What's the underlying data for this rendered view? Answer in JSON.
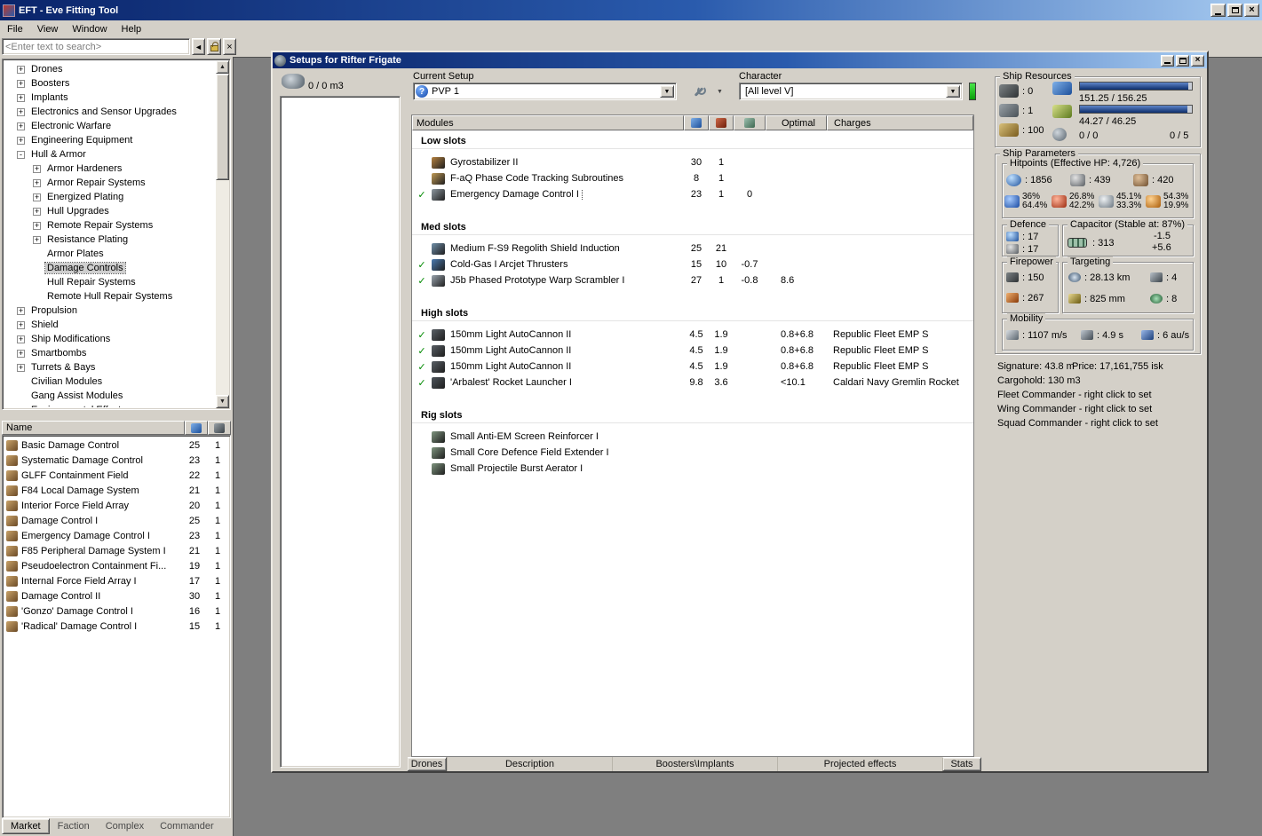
{
  "colors": {
    "titlebar_start": "#0a246a",
    "titlebar_end": "#a6caf0",
    "chrome": "#d4d0c8",
    "workspace": "#7f7f7f",
    "check_green": "#008a00",
    "indicator_green": "#22cc22",
    "bar_fill": "#0d2d6b"
  },
  "icons": {
    "dropdown_arrow": "▼",
    "back_arrow": "◄",
    "close": "×",
    "check": "✓",
    "expand": "+",
    "collapse": "-",
    "question": "?",
    "scroll_up": "▲",
    "scroll_down": "▼"
  },
  "app": {
    "title": "EFT - Eve Fitting Tool",
    "menu": [
      "File",
      "View",
      "Window",
      "Help"
    ],
    "search_placeholder": "<Enter text to search>"
  },
  "tree": {
    "items": [
      {
        "label": "Drones",
        "level": 0,
        "expand": "plus"
      },
      {
        "label": "Boosters",
        "level": 0,
        "expand": "plus"
      },
      {
        "label": "Implants",
        "level": 0,
        "expand": "plus"
      },
      {
        "label": "Electronics and Sensor Upgrades",
        "level": 0,
        "expand": "plus"
      },
      {
        "label": "Electronic Warfare",
        "level": 0,
        "expand": "plus"
      },
      {
        "label": "Engineering Equipment",
        "level": 0,
        "expand": "plus"
      },
      {
        "label": "Hull & Armor",
        "level": 0,
        "expand": "minus"
      },
      {
        "label": "Armor Hardeners",
        "level": 1,
        "expand": "plus"
      },
      {
        "label": "Armor Repair Systems",
        "level": 1,
        "expand": "plus"
      },
      {
        "label": "Energized Plating",
        "level": 1,
        "expand": "plus"
      },
      {
        "label": "Hull Upgrades",
        "level": 1,
        "expand": "plus"
      },
      {
        "label": "Remote Repair Systems",
        "level": 1,
        "expand": "plus"
      },
      {
        "label": "Resistance Plating",
        "level": 1,
        "expand": "plus"
      },
      {
        "label": "Armor Plates",
        "level": 1,
        "expand": null
      },
      {
        "label": "Damage Controls",
        "level": 1,
        "expand": null,
        "selected": true
      },
      {
        "label": "Hull Repair Systems",
        "level": 1,
        "expand": null
      },
      {
        "label": "Remote Hull Repair Systems",
        "level": 1,
        "expand": null
      },
      {
        "label": "Propulsion",
        "level": 0,
        "expand": "plus"
      },
      {
        "label": "Shield",
        "level": 0,
        "expand": "plus"
      },
      {
        "label": "Ship Modifications",
        "level": 0,
        "expand": "plus"
      },
      {
        "label": "Smartbombs",
        "level": 0,
        "expand": "plus"
      },
      {
        "label": "Turrets & Bays",
        "level": 0,
        "expand": "plus"
      },
      {
        "label": "Civilian Modules",
        "level": 0,
        "expand": null
      },
      {
        "label": "Gang Assist Modules",
        "level": 0,
        "expand": null
      },
      {
        "label": "Environmental Effects",
        "level": 0,
        "expand": null
      }
    ]
  },
  "market": {
    "name_column": "Name",
    "rows": [
      {
        "name": "Basic Damage Control",
        "meta": "25",
        "qty": "1"
      },
      {
        "name": "Systematic Damage Control",
        "meta": "23",
        "qty": "1"
      },
      {
        "name": "GLFF Containment Field",
        "meta": "22",
        "qty": "1"
      },
      {
        "name": "F84 Local Damage System",
        "meta": "21",
        "qty": "1"
      },
      {
        "name": "Interior Force Field Array",
        "meta": "20",
        "qty": "1"
      },
      {
        "name": "Damage Control I",
        "meta": "25",
        "qty": "1"
      },
      {
        "name": "Emergency Damage Control I",
        "meta": "23",
        "qty": "1"
      },
      {
        "name": "F85 Peripheral Damage System I",
        "meta": "21",
        "qty": "1"
      },
      {
        "name": "Pseudoelectron Containment Fi...",
        "meta": "19",
        "qty": "1"
      },
      {
        "name": "Internal Force Field Array I",
        "meta": "17",
        "qty": "1"
      },
      {
        "name": "Damage Control II",
        "meta": "30",
        "qty": "1"
      },
      {
        "name": "'Gonzo' Damage Control I",
        "meta": "16",
        "qty": "1"
      },
      {
        "name": "'Radical' Damage Control I",
        "meta": "15",
        "qty": "1"
      }
    ]
  },
  "left_tabs": [
    {
      "label": "Market",
      "active": true
    },
    {
      "label": "Faction",
      "active": false
    },
    {
      "label": "Complex",
      "active": false
    },
    {
      "label": "Commander",
      "active": false
    }
  ],
  "setup": {
    "window_title": "Setups for Rifter Frigate",
    "current_setup_label": "Current Setup",
    "current_setup_value": "PVP 1",
    "character_label": "Character",
    "character_value": "[All level V]",
    "drone_bay_text": "0 / 0 m3",
    "table": {
      "modules_label": "Modules",
      "optimal_label": "Optimal",
      "charges_label": "Charges"
    },
    "sections": [
      {
        "name": "Low slots",
        "rows": [
          {
            "check": false,
            "name": "Gyrostabilizer II",
            "cpu": "30",
            "pg": "1",
            "cap": "",
            "optimal": "",
            "charges": "",
            "icon_color": "#b5813f"
          },
          {
            "check": false,
            "name": "F-aQ Phase Code Tracking Subroutines",
            "cpu": "8",
            "pg": "1",
            "cap": "",
            "optimal": "",
            "charges": "",
            "icon_color": "#c09a55"
          },
          {
            "check": true,
            "selected": true,
            "name": "Emergency Damage Control I",
            "cpu": "23",
            "pg": "1",
            "cap": "0",
            "optimal": "",
            "charges": "",
            "icon_color": "#8e98a0"
          }
        ]
      },
      {
        "name": "Med slots",
        "rows": [
          {
            "check": false,
            "name": "Medium F-S9 Regolith Shield Induction",
            "cpu": "25",
            "pg": "21",
            "cap": "",
            "optimal": "",
            "charges": "",
            "icon_color": "#6f8fa8"
          },
          {
            "check": true,
            "name": "Cold-Gas I Arcjet Thrusters",
            "cpu": "15",
            "pg": "10",
            "cap": "-0.7",
            "optimal": "",
            "charges": "",
            "icon_color": "#4a7ab0"
          },
          {
            "check": true,
            "name": "J5b Phased Prototype Warp Scrambler I",
            "cpu": "27",
            "pg": "1",
            "cap": "-0.8",
            "optimal": "8.6",
            "charges": "",
            "icon_color": "#9aa4ae"
          }
        ]
      },
      {
        "name": "High slots",
        "rows": [
          {
            "check": true,
            "name": "150mm Light AutoCannon II",
            "cpu": "4.5",
            "pg": "1.9",
            "cap": "",
            "optimal": "0.8+6.8",
            "charges": "Republic Fleet EMP S",
            "icon_color": "#5a6066"
          },
          {
            "check": true,
            "name": "150mm Light AutoCannon II",
            "cpu": "4.5",
            "pg": "1.9",
            "cap": "",
            "optimal": "0.8+6.8",
            "charges": "Republic Fleet EMP S",
            "icon_color": "#5a6066"
          },
          {
            "check": true,
            "name": "150mm Light AutoCannon II",
            "cpu": "4.5",
            "pg": "1.9",
            "cap": "",
            "optimal": "0.8+6.8",
            "charges": "Republic Fleet EMP S",
            "icon_color": "#5a6066"
          },
          {
            "check": true,
            "name": "'Arbalest' Rocket Launcher I",
            "cpu": "9.8",
            "pg": "3.6",
            "cap": "",
            "optimal": "<10.1",
            "charges": "Caldari Navy Gremlin Rocket",
            "icon_color": "#4e555c"
          }
        ]
      },
      {
        "name": "Rig slots",
        "rows": [
          {
            "check": false,
            "name": "Small Anti-EM Screen Reinforcer I",
            "cpu": "",
            "pg": "",
            "cap": "",
            "optimal": "",
            "charges": "",
            "icon_color": "#7f957f"
          },
          {
            "check": false,
            "name": "Small Core Defence Field Extender I",
            "cpu": "",
            "pg": "",
            "cap": "",
            "optimal": "",
            "charges": "",
            "icon_color": "#7f957f"
          },
          {
            "check": false,
            "name": "Small Projectile Burst Aerator I",
            "cpu": "",
            "pg": "",
            "cap": "",
            "optimal": "",
            "charges": "",
            "icon_color": "#7f957f"
          }
        ]
      }
    ],
    "footer_tabs": [
      {
        "label": "Drones",
        "raised": true
      },
      {
        "label": "Description",
        "raised": false
      },
      {
        "label": "Boosters\\Implants",
        "raised": false
      },
      {
        "label": "Projected effects",
        "raised": false
      },
      {
        "label": "Stats",
        "raised": true
      }
    ]
  },
  "right": {
    "resources": {
      "title": "Ship Resources",
      "turrets": "0",
      "launchers": "1",
      "calibration": "100",
      "cpu": "151.25 / 156.25",
      "powergrid": "44.27 / 46.25",
      "dronebay": "0 / 0",
      "drones": "0 / 5",
      "cpu_pct": 97,
      "pg_pct": 96
    },
    "parameters": {
      "title": "Ship Parameters",
      "hitpoints": {
        "title": "Hitpoints (Effective HP: 4,726)",
        "shield_hp": "1856",
        "armor_hp": "439",
        "hull_hp": "420",
        "resists": [
          {
            "type": "em",
            "top": "36%",
            "bottom": "64.4%"
          },
          {
            "type": "thermal",
            "top": "26.8%",
            "bottom": "42.2%"
          },
          {
            "type": "kinetic",
            "top": "45.1%",
            "bottom": "33.3%"
          },
          {
            "type": "explosive",
            "top": "54.3%",
            "bottom": "19.9%"
          }
        ]
      },
      "defence": {
        "title": "Defence",
        "row1": "17",
        "row2": "17"
      },
      "capacitor": {
        "title": "Capacitor (Stable at: 87%)",
        "capacity": "313",
        "usage": "-1.5",
        "recharge": "+5.6"
      },
      "firepower": {
        "title": "Firepower",
        "volley": "150",
        "dps": "267"
      },
      "targeting": {
        "title": "Targeting",
        "range": "28.13 km",
        "max_targets": "4",
        "scan_resolution": "825 mm",
        "sensor_strength": "8"
      },
      "mobility": {
        "title": "Mobility",
        "max_velocity": "1107 m/s",
        "align_time": "4.9 s",
        "warp_speed": "6 au/s"
      }
    },
    "info": {
      "signature": "Signature: 43.8 m",
      "price": "Price: 17,161,755 isk",
      "cargohold": "Cargohold: 130 m3",
      "fleet_commander": "Fleet Commander - right click to set",
      "wing_commander": "Wing Commander - right click to set",
      "squad_commander": "Squad Commander - right click to set"
    }
  }
}
